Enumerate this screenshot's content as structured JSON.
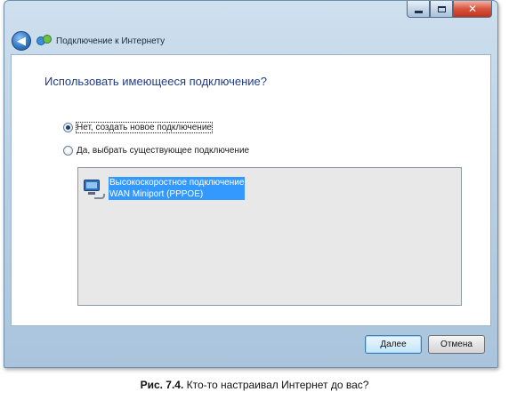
{
  "window": {
    "title": "Подключение к Интернету",
    "controls": {
      "minimize_icon": "minimize-icon",
      "maximize_icon": "maximize-icon",
      "close_icon": "close-icon",
      "close_glyph": "✕"
    },
    "back_icon": "back-arrow-icon",
    "back_glyph": "◀",
    "app_icon": "network-icon"
  },
  "main": {
    "question": "Использовать имеющееся подключение?",
    "options": [
      {
        "label": "Нет, создать новое подключение",
        "selected": true,
        "focused": true
      },
      {
        "label": "Да, выбрать существующее подключение",
        "selected": false,
        "focused": false
      }
    ],
    "connections": [
      {
        "name": "Высокоскоростное подключение",
        "device": "WAN Miniport (PPPOE)",
        "icon": "broadband-connection-icon",
        "selected": true
      }
    ]
  },
  "footer": {
    "next_label": "Далее",
    "cancel_label": "Отмена"
  },
  "caption": {
    "figure": "Рис. 7.4.",
    "text": " Кто-то настраивал Интернет до вас?"
  },
  "colors": {
    "heading": "#1f3c8a",
    "selection": "#3399ff",
    "list_background": "#e8e8e8"
  }
}
